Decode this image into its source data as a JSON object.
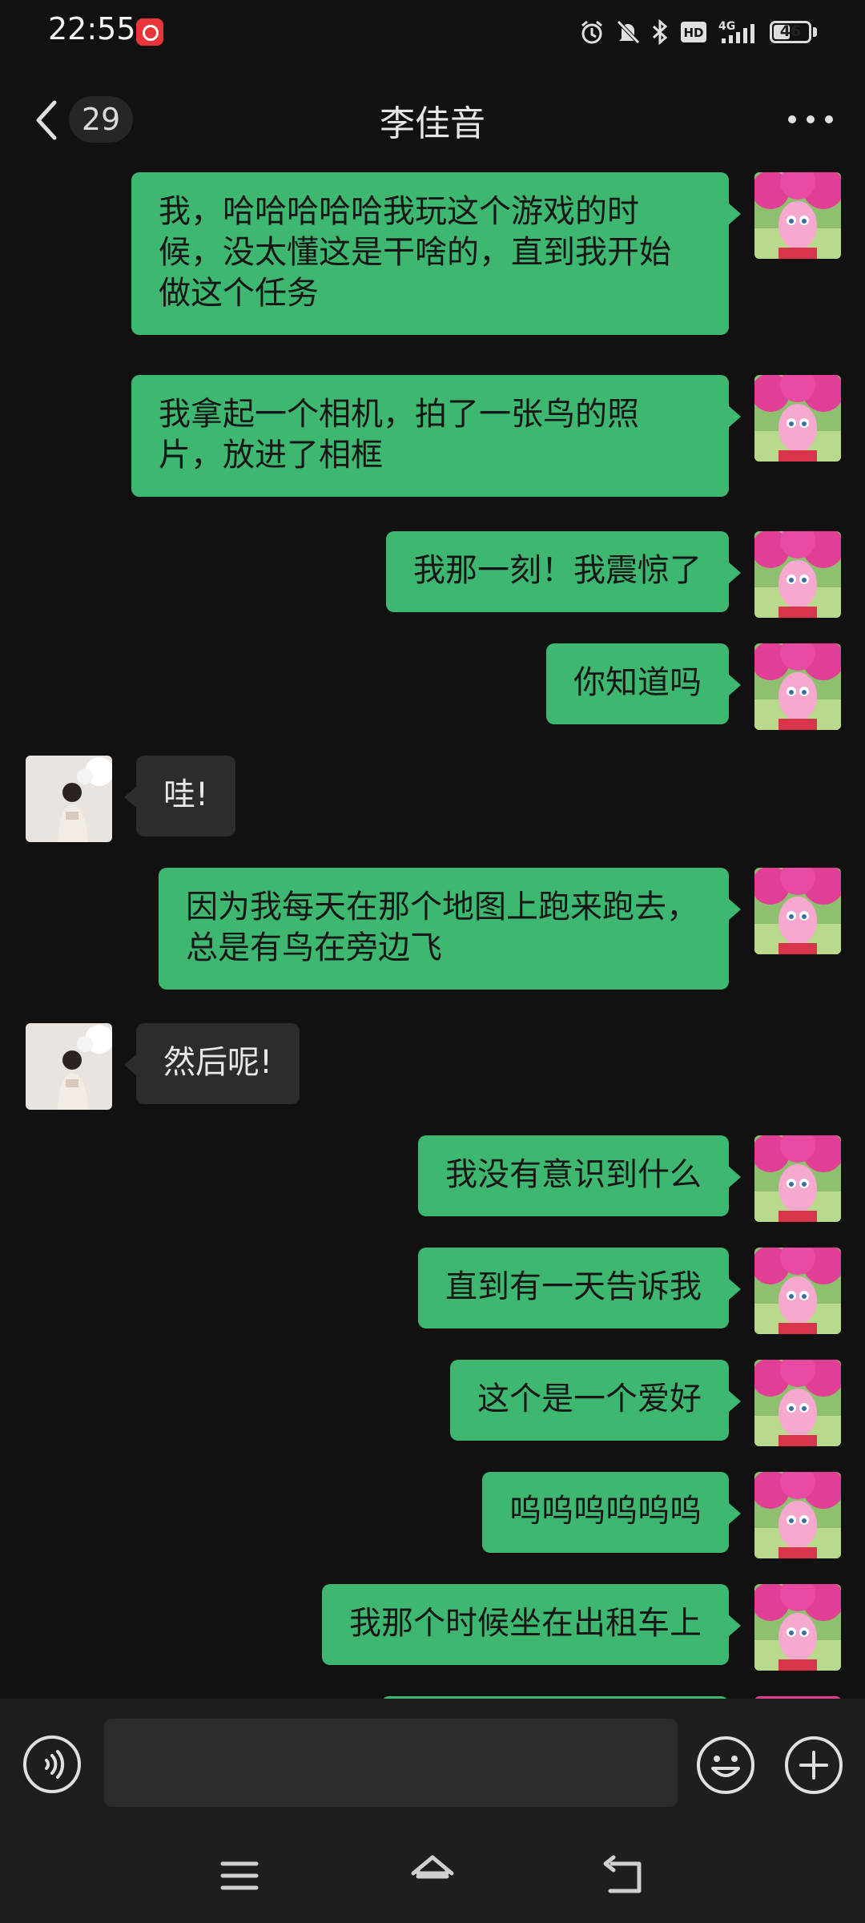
{
  "status_bar": {
    "time": "22:55",
    "battery": "46",
    "network": "4G",
    "hd": "HD",
    "icons": [
      "netease-music-icon",
      "alarm-icon",
      "mute-bell-icon",
      "bluetooth-icon",
      "hd-icon",
      "signal-icon",
      "battery-icon"
    ]
  },
  "header": {
    "unread_count": "29",
    "title": "李佳音",
    "back_icon": "chevron-left-icon",
    "more_icon": "more-dots-icon"
  },
  "colors": {
    "background": "#111111",
    "sent_bubble": "#3eb871",
    "received_bubble": "#2c2c2c",
    "bar": "#1e1e1e"
  },
  "messages": [
    {
      "side": "right",
      "text": "我，哈哈哈哈哈我玩这个游戏的时候，没太懂这是干啥的，直到我开始做这个任务"
    },
    {
      "side": "right",
      "text": "我拿起一个相机，拍了一张鸟的照片，放进了相框"
    },
    {
      "side": "right",
      "text": "我那一刻！我震惊了"
    },
    {
      "side": "right",
      "text": "你知道吗"
    },
    {
      "side": "left",
      "text": "哇!"
    },
    {
      "side": "right",
      "text": "因为我每天在那个地图上跑来跑去，总是有鸟在旁边飞"
    },
    {
      "side": "left",
      "text": "然后呢!"
    },
    {
      "side": "right",
      "text": "我没有意识到什么"
    },
    {
      "side": "right",
      "text": "直到有一天告诉我"
    },
    {
      "side": "right",
      "text": "这个是一个爱好"
    },
    {
      "side": "right",
      "text": "呜呜呜呜呜呜"
    },
    {
      "side": "right",
      "text": "我那个时候坐在出租车上"
    }
  ],
  "input_bar": {
    "voice_icon": "voice-icon",
    "input_value": "",
    "emoji_icon": "emoji-icon",
    "plus_icon": "plus-icon"
  },
  "nav_bar": {
    "icons": [
      "menu-icon",
      "home-icon",
      "back-icon"
    ]
  }
}
